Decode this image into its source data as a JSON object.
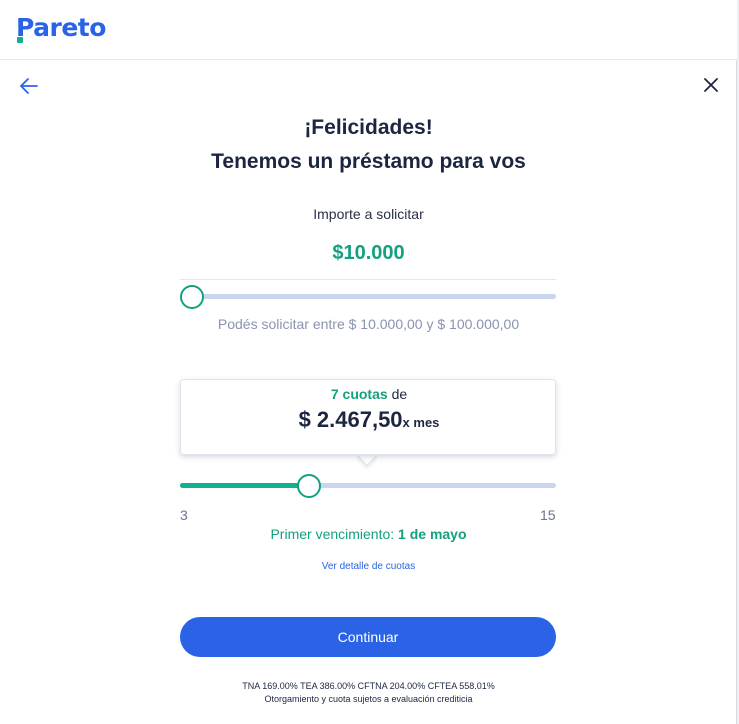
{
  "brand": {
    "name": "Pareto",
    "primary_color": "#2a63e6",
    "accent_color": "#12a17f"
  },
  "nav": {
    "back_icon": "arrow-left-icon",
    "close_icon": "close-icon"
  },
  "heading": {
    "line1": "¡Felicidades!",
    "line2": "Tenemos un préstamo para vos"
  },
  "amount_section": {
    "label": "Importe a solicitar",
    "value": "$10.000",
    "slider_level": 0,
    "range_hint": "Podés solicitar entre $ 10.000,00 y $ 100.000,00"
  },
  "installments": {
    "count_text": "7 cuotas",
    "connector": "de",
    "amount": "$ 2.467,50",
    "per": "x mes",
    "slider_value": 7,
    "min": "3",
    "max": "15"
  },
  "due": {
    "label": "Primer vencimiento:",
    "date": "1 de mayo"
  },
  "detail_link": "Ver detalle de cuotas",
  "continue_label": "Continuar",
  "legal": {
    "rates": "TNA 169.00% TEA 386.00% CFTNA 204.00% CFTEA 558.01%",
    "disclaimer": "Otorgamiento y cuota sujetos a evaluación crediticia"
  }
}
